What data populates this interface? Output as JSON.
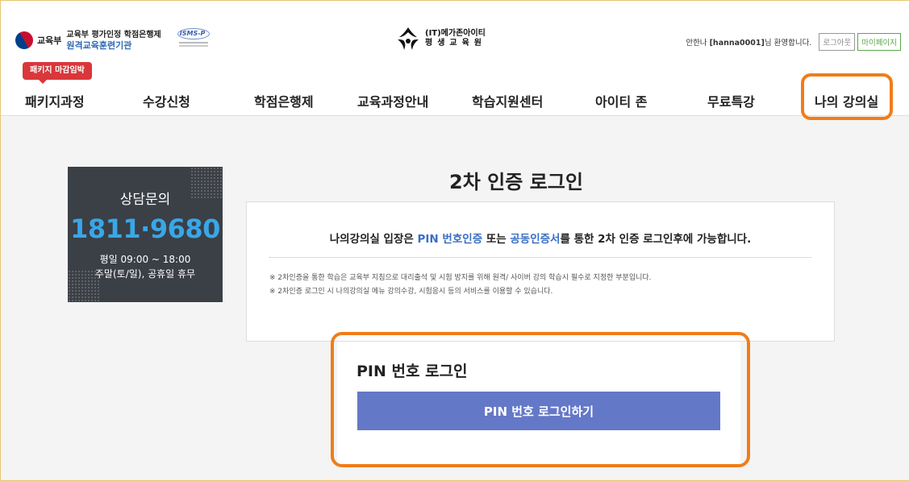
{
  "header": {
    "moe_label": "교육부",
    "institution_line1": "교육부 평가인정 학점은행제",
    "institution_line2": "원격교육훈련기관",
    "isms_label": "ISMS-P",
    "brand_line1": "(IT)메가존아이티",
    "brand_line2": "평생교육원",
    "welcome_prefix": "안한나",
    "welcome_user": "[hanna0001]",
    "welcome_suffix": "님 환영합니다.",
    "logout_label": "로그아웃",
    "mypage_label": "마이페이지",
    "deadline_badge": "패키지 마감임박"
  },
  "nav": {
    "items": [
      "패키지과정",
      "수강신청",
      "학점은행제",
      "교육과정안내",
      "학습지원센터",
      "아이티 존",
      "무료특강",
      "나의 강의실"
    ]
  },
  "consult": {
    "title": "상담문의",
    "phone": "1811·9680",
    "weekday_hours": "평일 09:00 ~ 18:00",
    "weekend": "주말(토/일), 공휴일 휴무"
  },
  "main": {
    "title": "2차 인증 로그인",
    "info_part1": "나의강의실 입장은 ",
    "info_pin": "PIN 번호인증",
    "info_part2": " 또는 ",
    "info_cert": "공동인증서",
    "info_part3": "를 통한 2차 인증 로그인후에 가능합니다.",
    "note1": "※ 2차인증을 통한 학습은 교육부 지침으로 대리출석 및 시험 방지를 위해 원격/ 사이버 강의 학습시 필수로 지정한 부분입니다.",
    "note2": "※ 2차인증 로그인 시 나의강의실 메뉴 강의수강, 시험응시 등의 서비스를 이용할 수 있습니다."
  },
  "pin": {
    "title": "PIN 번호 로그인",
    "button_label": "PIN 번호 로그인하기"
  },
  "colors": {
    "highlight": "#f07d1a",
    "pin_button": "#6478c8",
    "phone": "#38a7e8",
    "link_blue": "#3b6fc4",
    "badge_red": "#d9373b"
  }
}
